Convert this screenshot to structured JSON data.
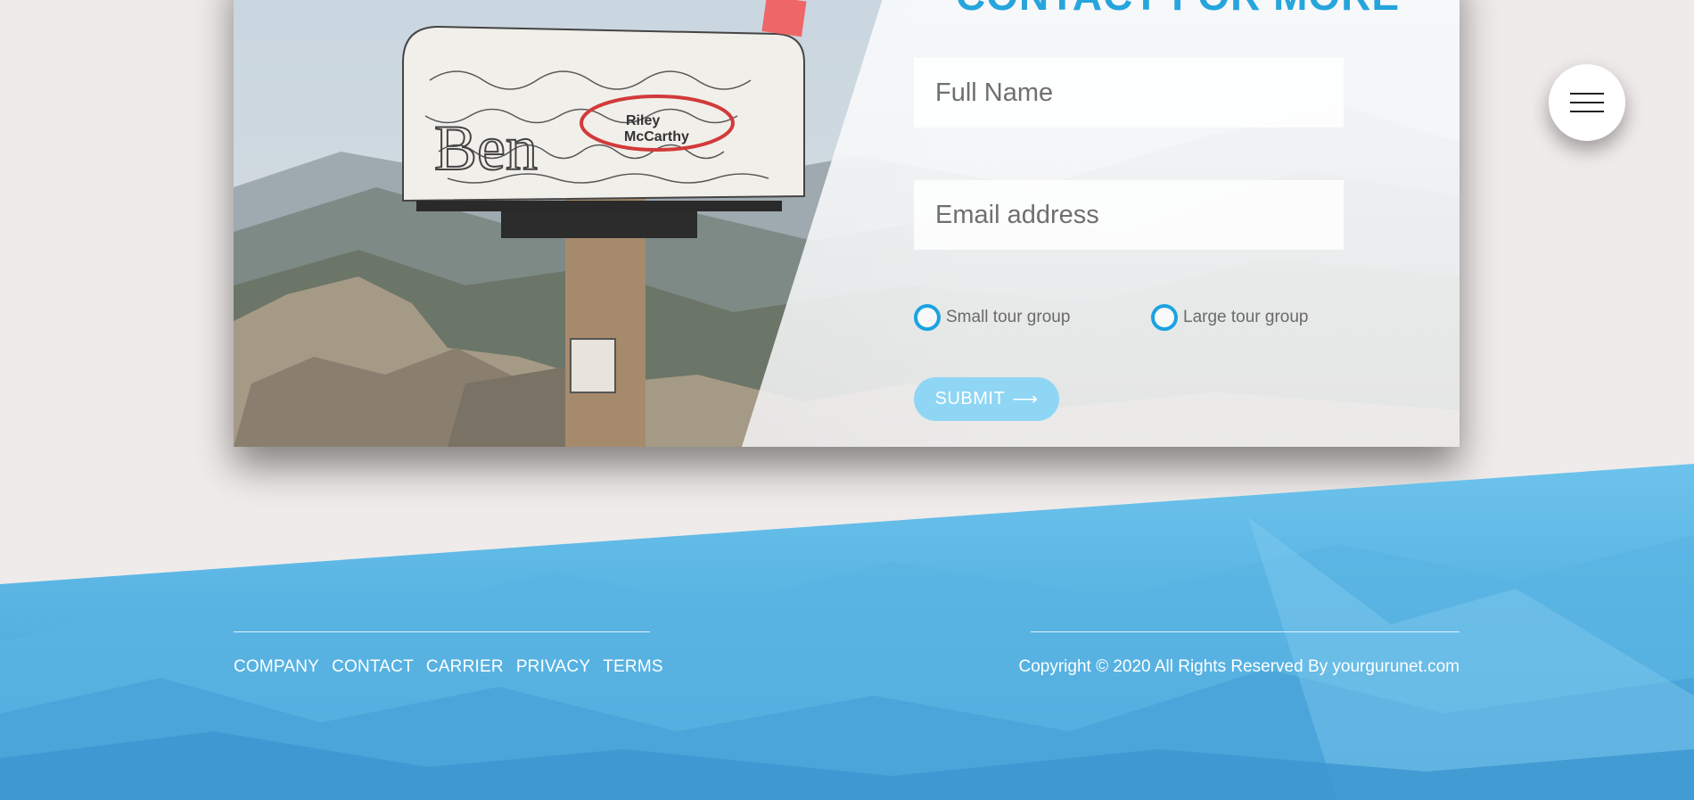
{
  "form": {
    "title": "CONTACT FOR MORE",
    "full_name_placeholder": "Full Name",
    "email_placeholder": "Email address",
    "radio_options": [
      "Small tour group",
      "Large tour group"
    ],
    "submit_label": "SUBMIT",
    "submit_arrow": "⟶"
  },
  "photo": {
    "mailbox_sticker_1": "Riley",
    "mailbox_sticker_2": "McCarthy",
    "mailbox_graffiti": "Ben"
  },
  "footer": {
    "nav": [
      "COMPANY",
      "CONTACT",
      "CARRIER",
      "PRIVACY",
      "TERMS"
    ],
    "copyright": "Copyright © 2020 All Rights Reserved By yourgurunet.com"
  },
  "colors": {
    "accent": "#26a5dd",
    "submit_bg": "#8fd6f5",
    "footer_blue": "#4aa8dc",
    "page_bg": "#efebea"
  }
}
